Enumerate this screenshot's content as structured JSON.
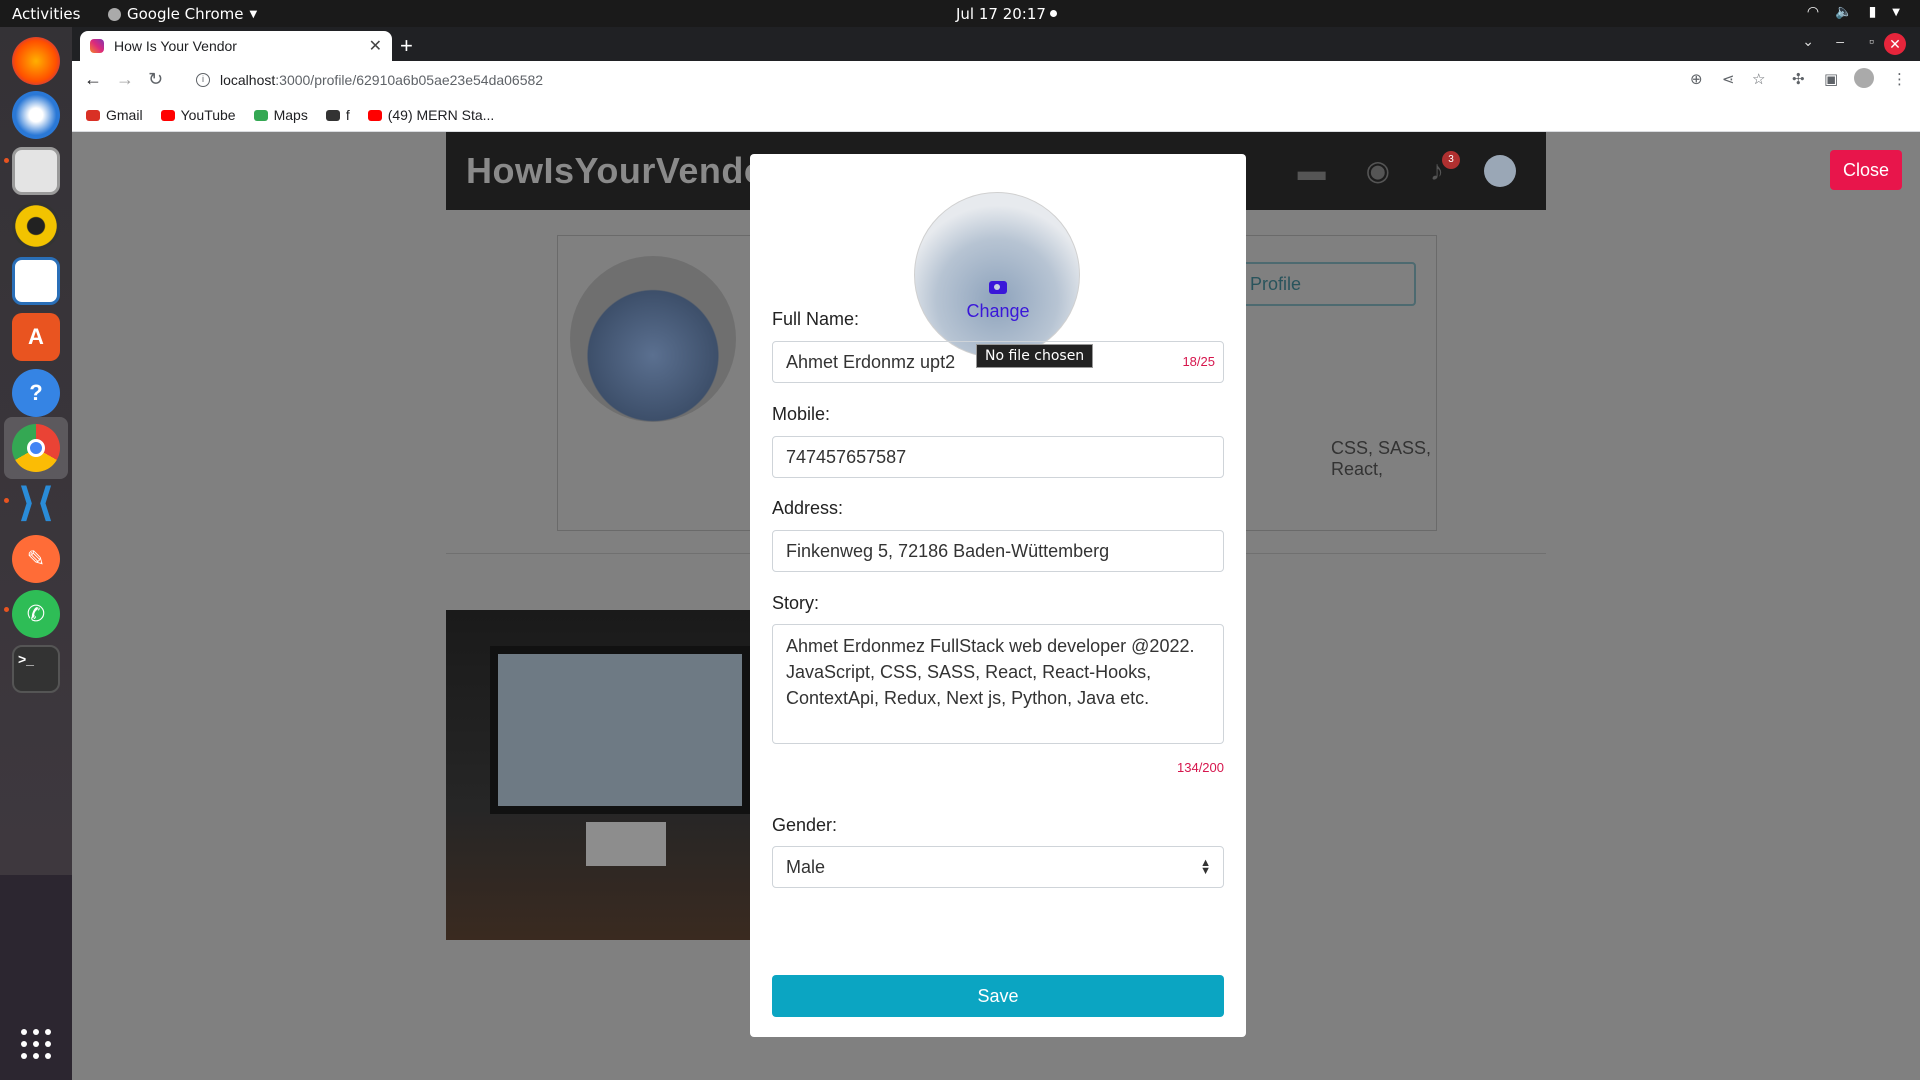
{
  "system": {
    "activities": "Activities",
    "app_menu": "Google Chrome",
    "clock": "Jul 17  20:17"
  },
  "browser": {
    "tab_title": "How Is Your Vendor",
    "url_host": "localhost",
    "url_path": ":3000/profile/62910a6b05ae23e54da06582",
    "bookmarks": [
      {
        "label": "Gmail",
        "color": "#d93025"
      },
      {
        "label": "YouTube",
        "color": "#ff0000"
      },
      {
        "label": "Maps",
        "color": "#34a853"
      },
      {
        "label": "f",
        "color": "#333333"
      },
      {
        "label": "(49) MERN Sta...",
        "color": "#ff0000"
      }
    ]
  },
  "page": {
    "brand": "HowIsYourVendo",
    "notifications_count": "3",
    "edit_profile_label": "it Profile",
    "story_fragment": "CSS, SASS, React,",
    "close_label": "Close"
  },
  "modal": {
    "change_label": "Change",
    "file_tooltip": "No file chosen",
    "full_name": {
      "label": "Full Name:",
      "value": "Ahmet Erdonmz upt2",
      "counter": "18/25"
    },
    "mobile": {
      "label": "Mobile:",
      "value": "747457657587"
    },
    "address": {
      "label": "Address:",
      "value": "Finkenweg 5, 72186 Baden-Wüttemberg"
    },
    "story": {
      "label": "Story:",
      "value": "Ahmet Erdonmez FullStack web developer @2022. JavaScript, CSS, SASS, React, React-Hooks, ContextApi, Redux, Next js, Python, Java etc.",
      "counter": "134/200"
    },
    "gender": {
      "label": "Gender:",
      "value": "Male"
    },
    "save_label": "Save"
  }
}
